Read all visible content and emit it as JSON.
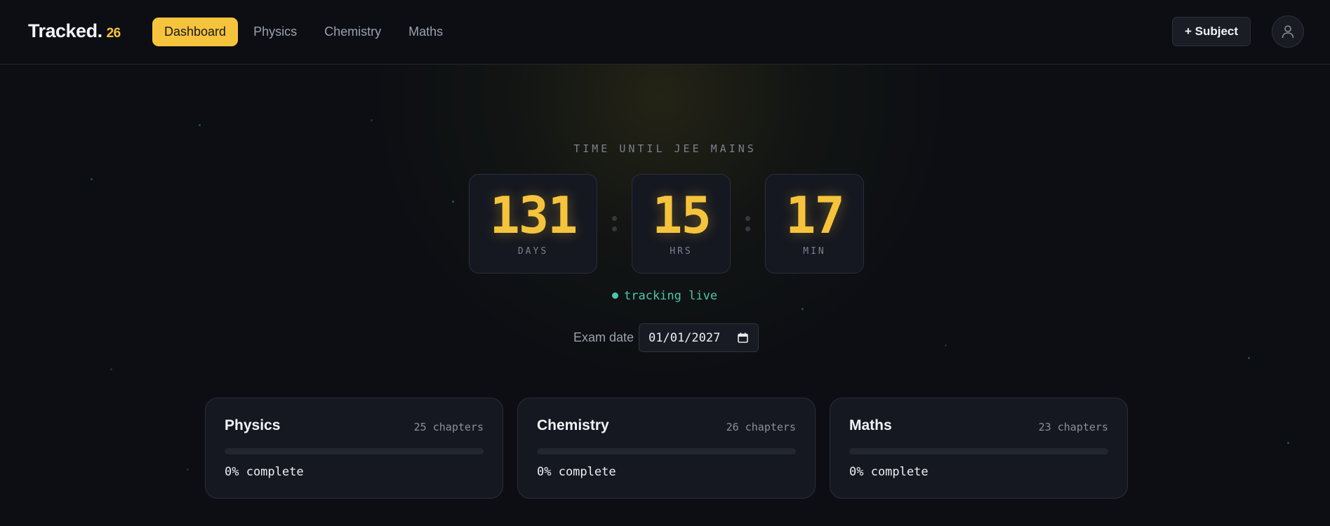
{
  "header": {
    "brand": "Tracked.",
    "brand_year": "26",
    "tabs": [
      {
        "label": "Dashboard",
        "active": true
      },
      {
        "label": "Physics",
        "active": false
      },
      {
        "label": "Chemistry",
        "active": false
      },
      {
        "label": "Maths",
        "active": false
      }
    ],
    "add_subject_label": "+ Subject",
    "avatar_icon": "user-icon"
  },
  "countdown": {
    "label": "TIME UNTIL JEE MAINS",
    "days": {
      "value": "131",
      "unit": "DAYS"
    },
    "hours": {
      "value": "15",
      "unit": "HRS"
    },
    "minutes": {
      "value": "17",
      "unit": "MIN"
    },
    "status": "tracking live"
  },
  "exam": {
    "label": "Exam date",
    "value": "01/01/2027",
    "icon": "calendar-icon"
  },
  "subjects": [
    {
      "name": "Physics",
      "chapters": "25 chapters",
      "progress": 0,
      "progress_label": "0% complete"
    },
    {
      "name": "Chemistry",
      "chapters": "26 chapters",
      "progress": 0,
      "progress_label": "0% complete"
    },
    {
      "name": "Maths",
      "chapters": "23 chapters",
      "progress": 0,
      "progress_label": "0% complete"
    }
  ],
  "colors": {
    "accent": "#f6c43c",
    "live": "#4cc6a9",
    "background": "#0c0e13",
    "card": "#151821"
  }
}
